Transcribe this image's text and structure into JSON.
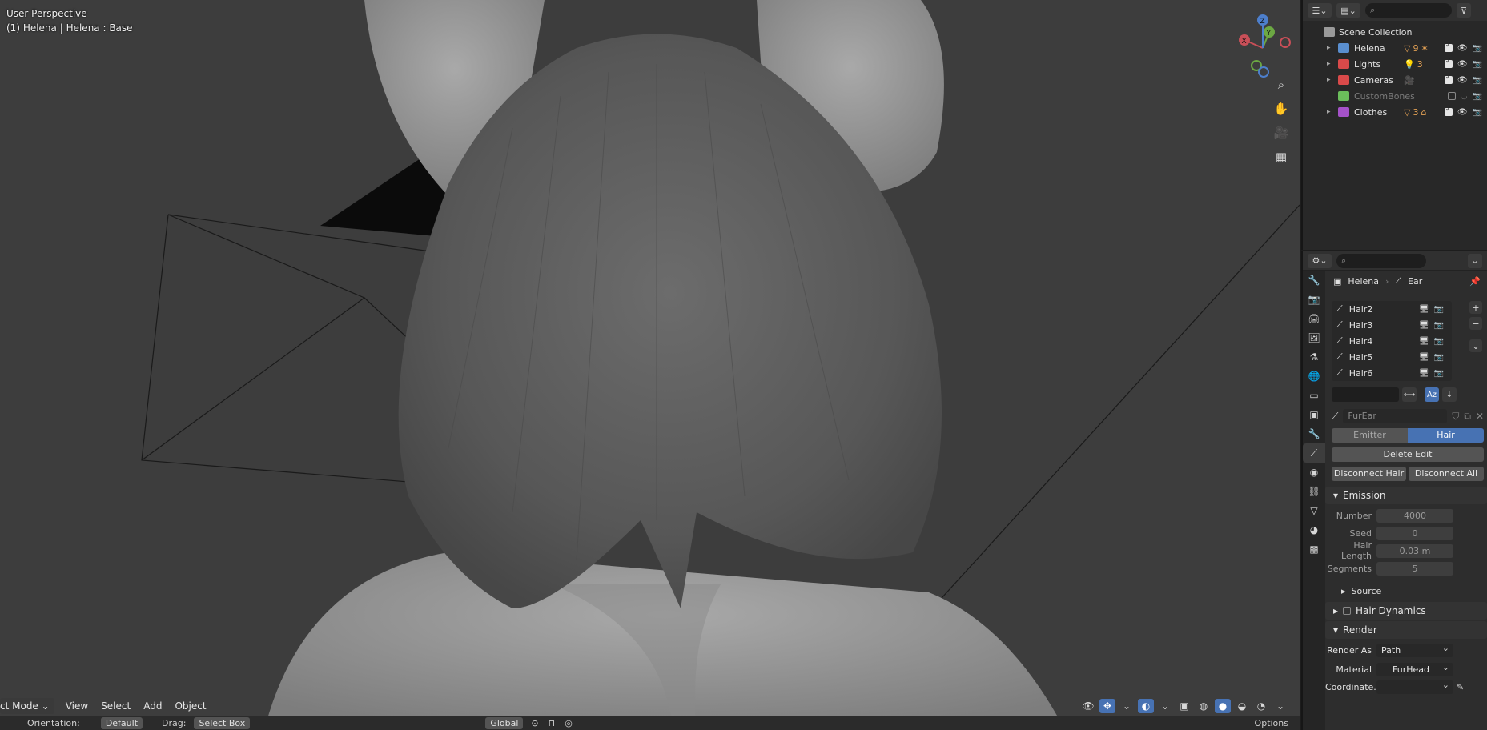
{
  "viewport": {
    "perspective_label": "User Perspective",
    "object_label": "(1) Helena | Helena : Base",
    "header": {
      "mode_label": "ct Mode",
      "menus": [
        "View",
        "Select",
        "Add",
        "Object"
      ]
    },
    "tool_settings": {
      "orientation_label": "Orientation:",
      "orientation_value": "Default",
      "drag_label": "Drag:",
      "drag_value": "Select Box",
      "transform_label": "Global",
      "options_label": "Options"
    },
    "gizmo": {
      "x": "X",
      "y": "Y",
      "z": "Z"
    }
  },
  "outliner": {
    "root": "Scene Collection",
    "rows": [
      {
        "label": "Helena",
        "color": "#5a8fcf",
        "badge": "9",
        "enabled": true
      },
      {
        "label": "Lights",
        "color": "#d94a4a",
        "badge": "3",
        "enabled": true
      },
      {
        "label": "Cameras",
        "color": "#d94a4a",
        "badge": "",
        "enabled": true
      },
      {
        "label": "CustomBones",
        "color": "#6bbd5b",
        "badge": "",
        "enabled": false
      },
      {
        "label": "Clothes",
        "color": "#a552c9",
        "badge": "3",
        "enabled": true
      }
    ]
  },
  "properties": {
    "breadcrumb": {
      "object": "Helena",
      "system": "Ear"
    },
    "particle_list": [
      "Hair2",
      "Hair3",
      "Hair4",
      "Hair5",
      "Hair6"
    ],
    "particle_settings": "FurEar",
    "type_options": {
      "emitter": "Emitter",
      "hair": "Hair"
    },
    "buttons": {
      "delete_edit": "Delete Edit",
      "disconnect_hair": "Disconnect Hair",
      "disconnect_all": "Disconnect All"
    },
    "emission": {
      "title": "Emission",
      "number_label": "Number",
      "number": "4000",
      "seed_label": "Seed",
      "seed": "0",
      "hair_length_label": "Hair Length",
      "hair_length": "0.03 m",
      "segments_label": "Segments",
      "segments": "5",
      "source_label": "Source"
    },
    "hair_dynamics_label": "Hair Dynamics",
    "render": {
      "title": "Render",
      "render_as_label": "Render As",
      "render_as": "Path",
      "material_label": "Material",
      "material": "FurHead",
      "coordinate_label": "Coordinate..."
    }
  }
}
